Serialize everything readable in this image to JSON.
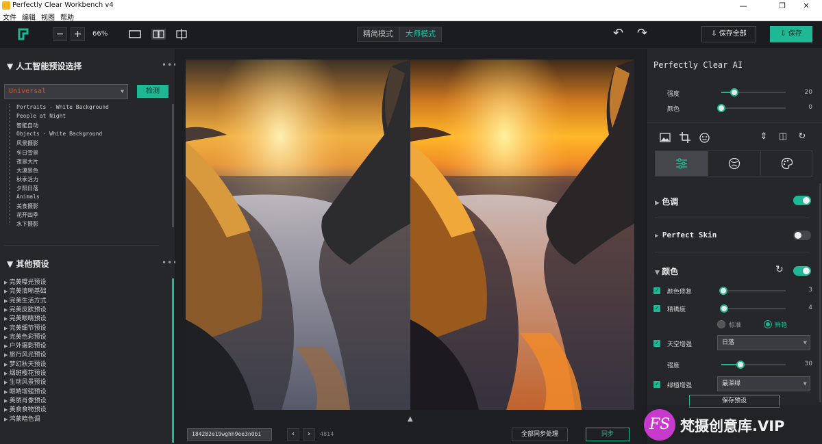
{
  "window": {
    "title": "Perfectly Clear Workbench v4",
    "minimize": "—",
    "maximize": "❐",
    "close": "✕"
  },
  "menu": [
    "文件",
    "编辑",
    "视图",
    "帮助"
  ],
  "toolbar": {
    "zoom": "66%",
    "zoom_out": "−",
    "zoom_in": "+",
    "mode_simple": "精简模式",
    "mode_master": "大师模式",
    "save_all": "保存全部",
    "save": "保存",
    "undo": "↶",
    "redo": "↷"
  },
  "left": {
    "ai_section_title": "人工智能预设选择",
    "preset_selected": "Universal",
    "detect_button": "检测",
    "ai_presets": [
      "Portraits - White Background",
      "People at Night",
      "智能自动",
      "Objects - White Background",
      "风景摄影",
      "冬日雪景",
      "夜景大片",
      "大漠景色",
      "秋季活力",
      "夕阳日落",
      "Animals",
      "美食摄影",
      "花开四季",
      "水下摄影"
    ],
    "other_section_title": "其他预设",
    "other_presets": [
      "完美曝光预设",
      "完美清晰基础",
      "完美生活方式",
      "完美皮肤预设",
      "完美眼睛预设",
      "完美细节预设",
      "完美色彩预设",
      "户外摄影预设",
      "旅行风光预设",
      "梦幻秋天预设",
      "烟斑樱花预设",
      "生动风景预设",
      "眼睛增强预设",
      "美丽肖像预设",
      "美食食物预设",
      "鸿蒙暗色调"
    ]
  },
  "canvas": {
    "filename": "184282e19wghh9ee3n0bi",
    "counter": "4814",
    "sync_all": "全部同步处理",
    "sync": "同步"
  },
  "right": {
    "header": "Perfectly Clear AI",
    "strength_label": "强度",
    "strength_value": "20",
    "strength_level": 0.2,
    "color_label": "颜色",
    "color_value": "0",
    "color_level": 0.0,
    "tone_section": "色调",
    "tone_on": true,
    "skin_section": "Perfect Skin",
    "skin_on": false,
    "color_section": "颜色",
    "color_on": true,
    "color_fix_label": "颜色修复",
    "color_fix_value": "3",
    "color_fix_level": 0.03,
    "vibrance_label": "精确度",
    "vibrance_value": "4",
    "vibrance_level": 0.04,
    "radio_standard": "标准",
    "radio_vivid": "鲜艳",
    "sky_label": "天空增强",
    "sky_option": "日落",
    "sky_strength_label": "强度",
    "sky_strength_value": "30",
    "sky_strength_level": 0.3,
    "foliage_label": "绿植增强",
    "foliage_option": "最深绿",
    "save_preset": "保存预设",
    "accent": "#1fb894"
  },
  "watermark": {
    "logo_text": "FS",
    "text": "梵摄创意库.VIP"
  }
}
